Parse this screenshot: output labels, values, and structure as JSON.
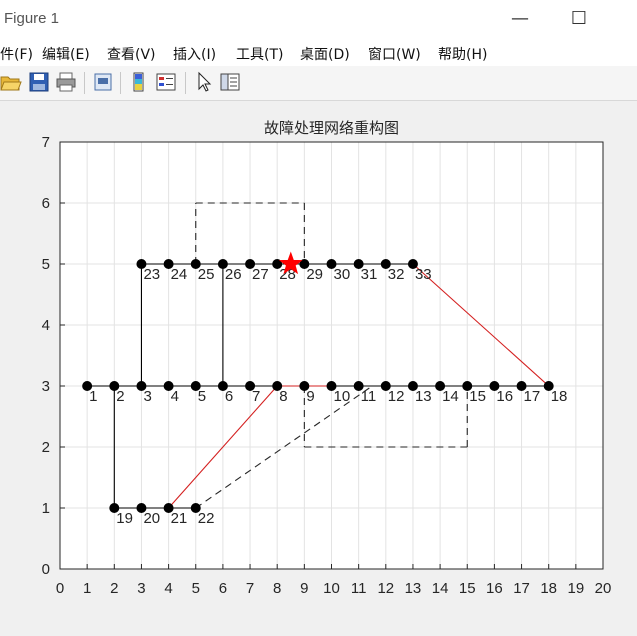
{
  "window": {
    "title": "Figure 1"
  },
  "window_controls": {
    "minimize": "—",
    "maximize": "☐",
    "close": "✕"
  },
  "menu": [
    {
      "label": "件(F)"
    },
    {
      "label": "编辑(E)"
    },
    {
      "label": "查看(V)"
    },
    {
      "label": "插入(I)"
    },
    {
      "label": "工具(T)"
    },
    {
      "label": "桌面(D)"
    },
    {
      "label": "窗口(W)"
    },
    {
      "label": "帮助(H)"
    }
  ],
  "toolbar": [
    {
      "icon": "open-folder-icon"
    },
    {
      "icon": "save-icon"
    },
    {
      "icon": "print-icon"
    },
    {
      "icon": "print-preview-icon"
    },
    {
      "icon": "colorbar-icon"
    },
    {
      "icon": "legend-icon"
    },
    {
      "icon": "pointer-icon"
    },
    {
      "icon": "property-editor-icon"
    }
  ],
  "chart_data": {
    "type": "scatter",
    "title": "故障处理网络重构图",
    "xlim": [
      0,
      20
    ],
    "ylim": [
      0,
      7
    ],
    "xticks": [
      0,
      1,
      2,
      3,
      4,
      5,
      6,
      7,
      8,
      9,
      10,
      11,
      12,
      13,
      14,
      15,
      16,
      17,
      18,
      19,
      20
    ],
    "yticks": [
      0,
      1,
      2,
      3,
      4,
      5,
      6,
      7
    ],
    "grid": true,
    "nodes": [
      {
        "label": "1",
        "x": 1,
        "y": 3
      },
      {
        "label": "2",
        "x": 2,
        "y": 3
      },
      {
        "label": "3",
        "x": 3,
        "y": 3
      },
      {
        "label": "4",
        "x": 4,
        "y": 3
      },
      {
        "label": "5",
        "x": 5,
        "y": 3
      },
      {
        "label": "6",
        "x": 6,
        "y": 3
      },
      {
        "label": "7",
        "x": 7,
        "y": 3
      },
      {
        "label": "8",
        "x": 8,
        "y": 3
      },
      {
        "label": "9",
        "x": 9,
        "y": 3
      },
      {
        "label": "10",
        "x": 10,
        "y": 3
      },
      {
        "label": "11",
        "x": 11,
        "y": 3
      },
      {
        "label": "12",
        "x": 12,
        "y": 3
      },
      {
        "label": "13",
        "x": 13,
        "y": 3
      },
      {
        "label": "14",
        "x": 14,
        "y": 3
      },
      {
        "label": "15",
        "x": 15,
        "y": 3
      },
      {
        "label": "16",
        "x": 16,
        "y": 3
      },
      {
        "label": "17",
        "x": 17,
        "y": 3
      },
      {
        "label": "18",
        "x": 18,
        "y": 3
      },
      {
        "label": "19",
        "x": 2,
        "y": 1
      },
      {
        "label": "20",
        "x": 3,
        "y": 1
      },
      {
        "label": "21",
        "x": 4,
        "y": 1
      },
      {
        "label": "22",
        "x": 5,
        "y": 1
      },
      {
        "label": "23",
        "x": 3,
        "y": 5
      },
      {
        "label": "24",
        "x": 4,
        "y": 5
      },
      {
        "label": "25",
        "x": 5,
        "y": 5
      },
      {
        "label": "26",
        "x": 6,
        "y": 5
      },
      {
        "label": "27",
        "x": 7,
        "y": 5
      },
      {
        "label": "28",
        "x": 8,
        "y": 5
      },
      {
        "label": "29",
        "x": 9,
        "y": 5
      },
      {
        "label": "30",
        "x": 10,
        "y": 5
      },
      {
        "label": "31",
        "x": 11,
        "y": 5
      },
      {
        "label": "32",
        "x": 12,
        "y": 5
      },
      {
        "label": "33",
        "x": 13,
        "y": 5
      }
    ],
    "solid_black_lines": [
      [
        [
          1,
          3
        ],
        [
          8,
          3
        ]
      ],
      [
        [
          9.9,
          3
        ],
        [
          18,
          3
        ]
      ],
      [
        [
          3,
          5
        ],
        [
          13,
          5
        ]
      ],
      [
        [
          2,
          3
        ],
        [
          2,
          1
        ]
      ],
      [
        [
          2,
          1
        ],
        [
          5,
          1
        ]
      ],
      [
        [
          3,
          3
        ],
        [
          3,
          5
        ]
      ],
      [
        [
          6,
          3
        ],
        [
          6,
          5
        ]
      ]
    ],
    "solid_red_lines": [
      [
        [
          4,
          1
        ],
        [
          8,
          3
        ]
      ],
      [
        [
          8,
          3
        ],
        [
          9.9,
          3
        ]
      ],
      [
        [
          13,
          5
        ],
        [
          18,
          3
        ]
      ]
    ],
    "dashed_lines": [
      [
        [
          5,
          5
        ],
        [
          5,
          6
        ]
      ],
      [
        [
          5,
          6
        ],
        [
          9,
          6
        ]
      ],
      [
        [
          9,
          6
        ],
        [
          9,
          5
        ]
      ],
      [
        [
          9,
          3
        ],
        [
          9,
          2
        ]
      ],
      [
        [
          9,
          2
        ],
        [
          15,
          2
        ]
      ],
      [
        [
          15,
          2
        ],
        [
          15,
          3
        ]
      ],
      [
        [
          5,
          1
        ],
        [
          11.5,
          3
        ]
      ]
    ],
    "fault": {
      "marker": "star",
      "x": 8.5,
      "y": 5,
      "color": "#ff0000"
    },
    "colors": {
      "line": "#000000",
      "red_line": "#d42020",
      "grid": "#e3e3e3"
    }
  }
}
